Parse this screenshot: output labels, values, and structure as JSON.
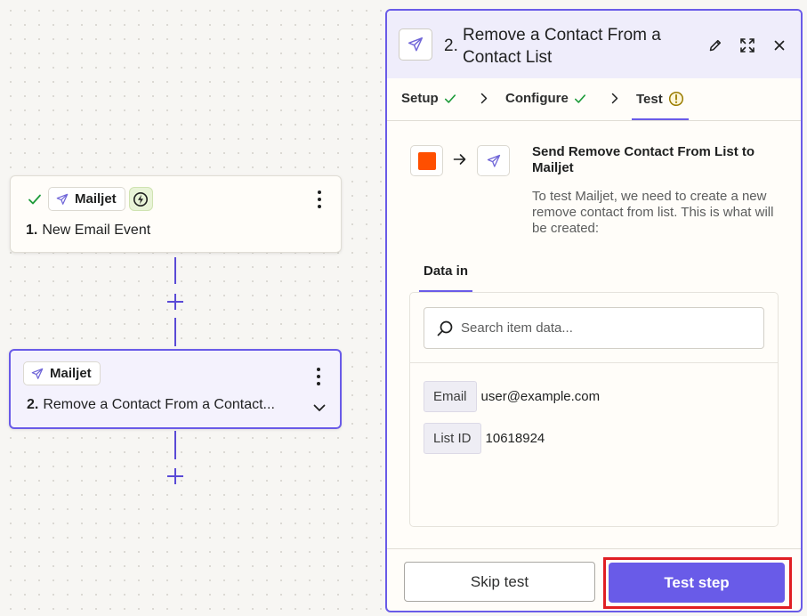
{
  "canvas": {
    "step1": {
      "app_name": "Mailjet",
      "number": "1.",
      "title": "New Email Event",
      "status": "complete",
      "trigger_badge": "instant"
    },
    "step2": {
      "app_name": "Mailjet",
      "number": "2.",
      "title": "Remove a Contact From a Contact...",
      "selected": true
    }
  },
  "panel": {
    "header": {
      "number": "2.",
      "title": "Remove a Contact From a Contact List"
    },
    "tabs": [
      {
        "label": "Setup",
        "status": "complete"
      },
      {
        "label": "Configure",
        "status": "complete"
      },
      {
        "label": "Test",
        "status": "warning",
        "active": true
      }
    ],
    "test": {
      "title": "Send Remove Contact From List to Mailjet",
      "description": "To test Mailjet, we need to create a new remove contact from list. This is what will be created:",
      "data_tab": "Data in",
      "search_placeholder": "Search item data...",
      "fields": [
        {
          "label": "Email",
          "value": "user@example.com"
        },
        {
          "label": "List ID",
          "value": "10618924"
        }
      ]
    },
    "footer": {
      "skip_label": "Skip test",
      "test_label": "Test step"
    }
  },
  "colors": {
    "accent": "#695be8",
    "success": "#1d9b3a",
    "warning": "#9a7c00",
    "app_orange": "#ff4f00",
    "highlight": "#e01e23"
  }
}
